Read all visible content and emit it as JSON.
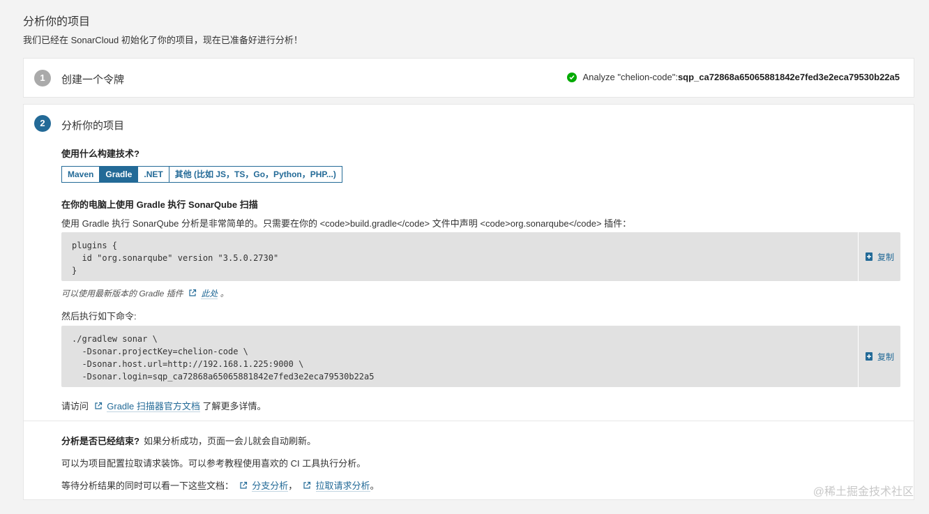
{
  "header": {
    "title": "分析你的项目",
    "subtitle": "我们已经在 SonarCloud 初始化了你的项目，现在已准备好进行分析！"
  },
  "step1": {
    "number": "1",
    "label": "创建一个令牌",
    "token_label": "Analyze \"chelion-code\":",
    "token_value": "sqp_ca72868a65065881842e7fed3e2eca79530b22a5"
  },
  "step2": {
    "number": "2",
    "label": "分析你的项目",
    "build_question": "使用什么构建技术?",
    "build_options": [
      "Maven",
      "Gradle",
      ".NET",
      "其他 (比如 JS，TS，Go，Python，PHP...)"
    ],
    "selected_option": "Gradle",
    "section_title": "在你的电脑上使用 Gradle 执行 SonarQube 扫描",
    "section_desc": "使用 Gradle 执行 SonarQube 分析是非常简单的。只需要在你的 <code>build.gradle</code> 文件中声明 <code>org.sonarqube</code> 插件：",
    "code1": "plugins {\n  id \"org.sonarqube\" version \"3.5.0.2730\"\n}",
    "copy_label": "复制",
    "plugin_note_prefix": "可以使用最新版本的 Gradle 插件",
    "plugin_note_link": "此处",
    "plugin_note_suffix": "。",
    "then_label": "然后执行如下命令:",
    "code2": "./gradlew sonar \\\n  -Dsonar.projectKey=chelion-code \\\n  -Dsonar.host.url=http://192.168.1.225:9000 \\\n  -Dsonar.login=sqp_ca72868a65065881842e7fed3e2eca79530b22a5",
    "visit_prefix": "请访问",
    "visit_link": "Gradle 扫描器官方文档",
    "visit_suffix": "了解更多详情。",
    "done_question": "分析是否已经结束?",
    "done_answer": "如果分析成功，页面一会儿就会自动刷新。",
    "pr_text": "可以为项目配置拉取请求装饰。可以参考教程使用喜欢的 CI 工具执行分析。",
    "docs_prefix": "等待分析结果的同时可以看一下这些文档：",
    "docs_link1": "分支分析",
    "docs_sep": "，",
    "docs_link2": "拉取请求分析",
    "docs_suffix": "。"
  },
  "watermark": "@稀土掘金技术社区",
  "colors": {
    "accent": "#236a97",
    "success": "#00aa00",
    "code_bg": "#e1e1e1"
  }
}
